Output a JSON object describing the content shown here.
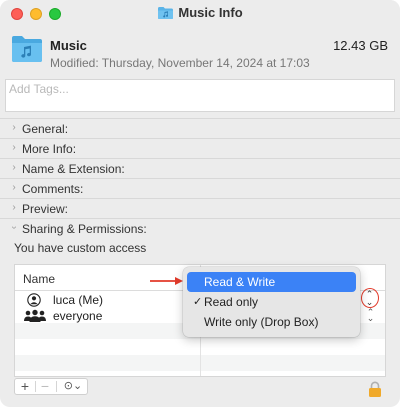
{
  "window": {
    "title": "Music Info"
  },
  "header": {
    "name": "Music",
    "size": "12.43 GB",
    "modified": "Modified: Thursday, November 14, 2024 at 17:03"
  },
  "tags": {
    "placeholder": "Add Tags..."
  },
  "sections": [
    {
      "label": "General:",
      "expanded": false
    },
    {
      "label": "More Info:",
      "expanded": false
    },
    {
      "label": "Name & Extension:",
      "expanded": false
    },
    {
      "label": "Comments:",
      "expanded": false
    },
    {
      "label": "Preview:",
      "expanded": false
    },
    {
      "label": "Sharing & Permissions:",
      "expanded": true
    }
  ],
  "sharing": {
    "access_note": "You have custom access",
    "column_name": "Name",
    "rows": [
      {
        "name": "luca (Me)",
        "icon": "user-icon"
      },
      {
        "name": "everyone",
        "icon": "group-icon"
      }
    ]
  },
  "privilege_menu": {
    "items": [
      {
        "label": "Read & Write",
        "highlighted": true,
        "checked": false
      },
      {
        "label": "Read only",
        "highlighted": false,
        "checked": true
      },
      {
        "label": "Write only (Drop Box)",
        "highlighted": false,
        "checked": false
      }
    ]
  },
  "bottom_bar": {
    "add": "+",
    "remove": "−",
    "action": "⊙⌄"
  },
  "colors": {
    "highlight": "#3b82f6",
    "annotation": "#e23a2a",
    "folder": "#5ab4e8",
    "lock": "#f0a92a"
  }
}
